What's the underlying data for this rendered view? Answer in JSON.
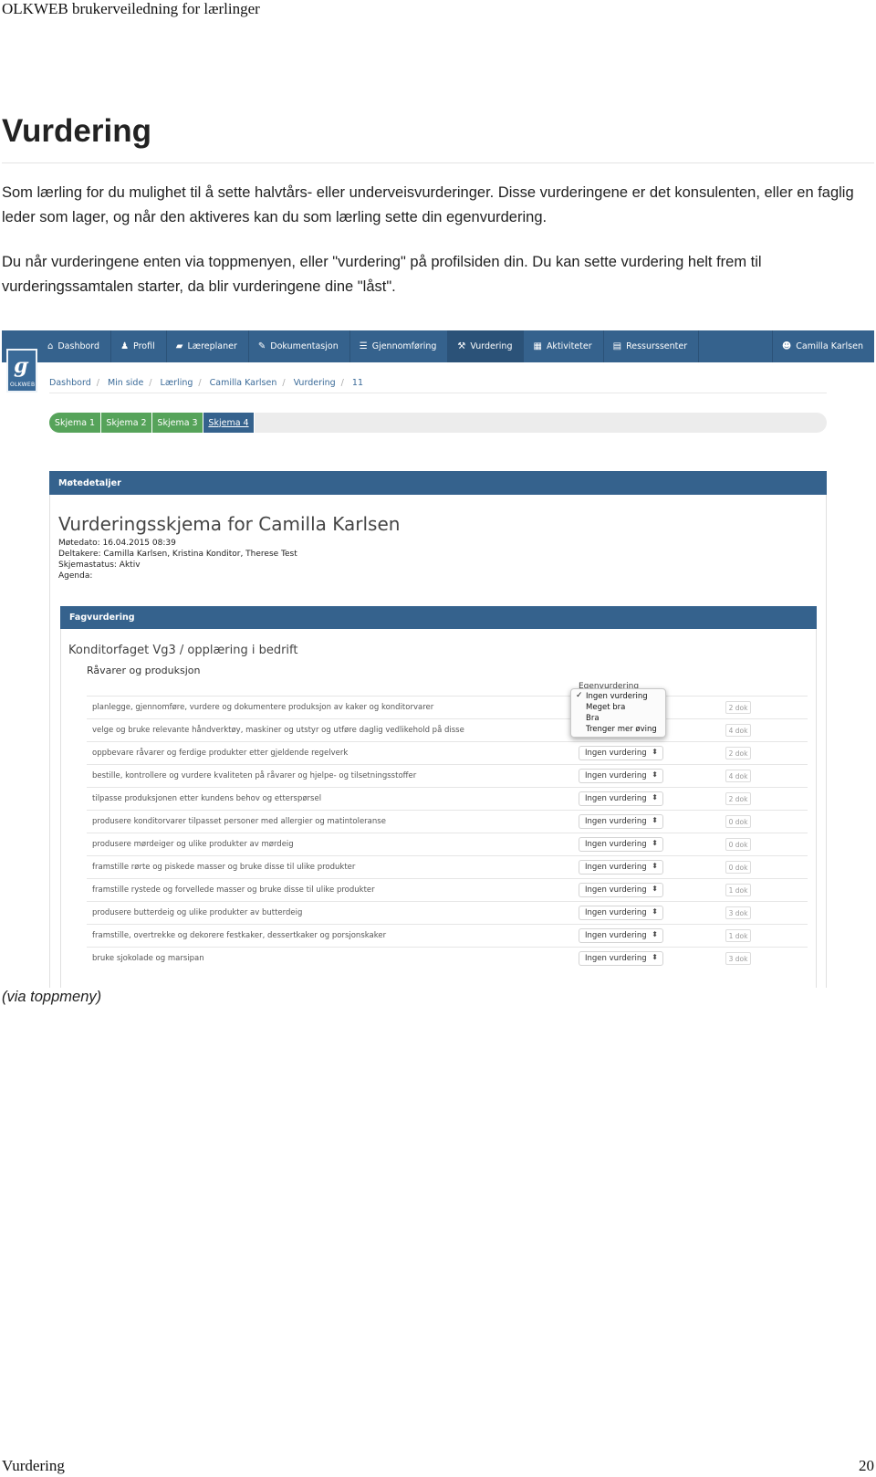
{
  "page": {
    "running_header": "OLKWEB brukerveiledning for lærlinger",
    "title": "Vurdering",
    "paragraphs": [
      "Som lærling for du mulighet til å sette halvtårs- eller underveisvurderinger. Disse vurderingene er det konsulenten, eller en faglig leder som lager, og når den aktiveres kan du som lærling sette din egenvurdering.",
      "Du når vurderingene enten via toppmenyen, eller \"vurdering\" på profilsiden din. Du kan sette vurdering helt frem til vurderingssamtalen starter, da blir vurderingene dine \"låst\"."
    ],
    "caption": "(via toppmeny)",
    "footer_left": "Vurdering",
    "footer_right": "20"
  },
  "screenshot": {
    "logo_text": "OLKWEB",
    "nav": [
      {
        "label": "Dashbord",
        "icon": "home-icon",
        "glyph": "⌂"
      },
      {
        "label": "Profil",
        "icon": "user-icon",
        "glyph": "♟"
      },
      {
        "label": "Læreplaner",
        "icon": "folder-icon",
        "glyph": "▰"
      },
      {
        "label": "Dokumentasjon",
        "icon": "pencil-icon",
        "glyph": "✎"
      },
      {
        "label": "Gjennomføring",
        "icon": "list-icon",
        "glyph": "☰"
      },
      {
        "label": "Vurdering",
        "icon": "gavel-icon",
        "glyph": "⚒"
      },
      {
        "label": "Aktiviteter",
        "icon": "calendar-icon",
        "glyph": "▦"
      },
      {
        "label": "Ressurssenter",
        "icon": "document-icon",
        "glyph": "▤"
      }
    ],
    "user": {
      "label": "Camilla Karlsen",
      "icon": "users-icon",
      "glyph": "☻"
    },
    "breadcrumb": [
      "Dashbord",
      "Min side",
      "Lærling",
      "Camilla Karlsen",
      "Vurdering",
      "11"
    ],
    "tabs": [
      "Skjema 1",
      "Skjema 2",
      "Skjema 3",
      "Skjema 4"
    ],
    "panel_title": "Møtedetaljer",
    "form_title": "Vurderingsskjema for Camilla Karlsen",
    "meta": [
      "Møtedato: 16.04.2015 08:39",
      "Deltakere: Camilla Karlsen, Kristina Konditor, Therese Test",
      "Skjemastatus: Aktiv",
      "Agenda:"
    ],
    "section_title": "Fagvurdering",
    "subject": "Konditorfaget Vg3 / opplæring i bedrift",
    "subsection": "Råvarer og produksjon",
    "column_header": "Egenvurdering",
    "dropdown_options": [
      "Ingen vurdering",
      "Meget bra",
      "Bra",
      "Trenger mer øving"
    ],
    "rows": [
      {
        "criterion": "planlegge, gjennomføre, vurdere og dokumentere produksjon av kaker og konditorvarer",
        "value": "",
        "dok": "2 dok"
      },
      {
        "criterion": "velge og bruke relevante håndverktøy, maskiner og utstyr og utføre daglig vedlikehold på disse",
        "value": "",
        "dok": "4 dok"
      },
      {
        "criterion": "oppbevare råvarer og ferdige produkter etter gjeldende regelverk",
        "value": "Ingen vurdering",
        "dok": "2 dok"
      },
      {
        "criterion": "bestille, kontrollere og vurdere kvaliteten på råvarer og hjelpe- og tilsetningsstoffer",
        "value": "Ingen vurdering",
        "dok": "4 dok"
      },
      {
        "criterion": "tilpasse produksjonen etter kundens behov og etterspørsel",
        "value": "Ingen vurdering",
        "dok": "2 dok"
      },
      {
        "criterion": "produsere konditorvarer tilpasset personer med allergier og matintoleranse",
        "value": "Ingen vurdering",
        "dok": "0 dok"
      },
      {
        "criterion": "produsere mørdeiger og ulike produkter av mørdeig",
        "value": "Ingen vurdering",
        "dok": "0 dok"
      },
      {
        "criterion": "framstille rørte og piskede masser og bruke disse til ulike produkter",
        "value": "Ingen vurdering",
        "dok": "0 dok"
      },
      {
        "criterion": "framstille rystede og forvellede masser og bruke disse til ulike produkter",
        "value": "Ingen vurdering",
        "dok": "1 dok"
      },
      {
        "criterion": "produsere butterdeig og ulike produkter av butterdeig",
        "value": "Ingen vurdering",
        "dok": "3 dok"
      },
      {
        "criterion": "framstille, overtrekke og dekorere festkaker, dessertkaker og porsjonskaker",
        "value": "Ingen vurdering",
        "dok": "1 dok"
      },
      {
        "criterion": "bruke sjokolade og marsipan",
        "value": "Ingen vurdering",
        "dok": "3 dok"
      }
    ],
    "colors": {
      "nav": "#35628d",
      "tab_active": "#56a35a"
    }
  }
}
